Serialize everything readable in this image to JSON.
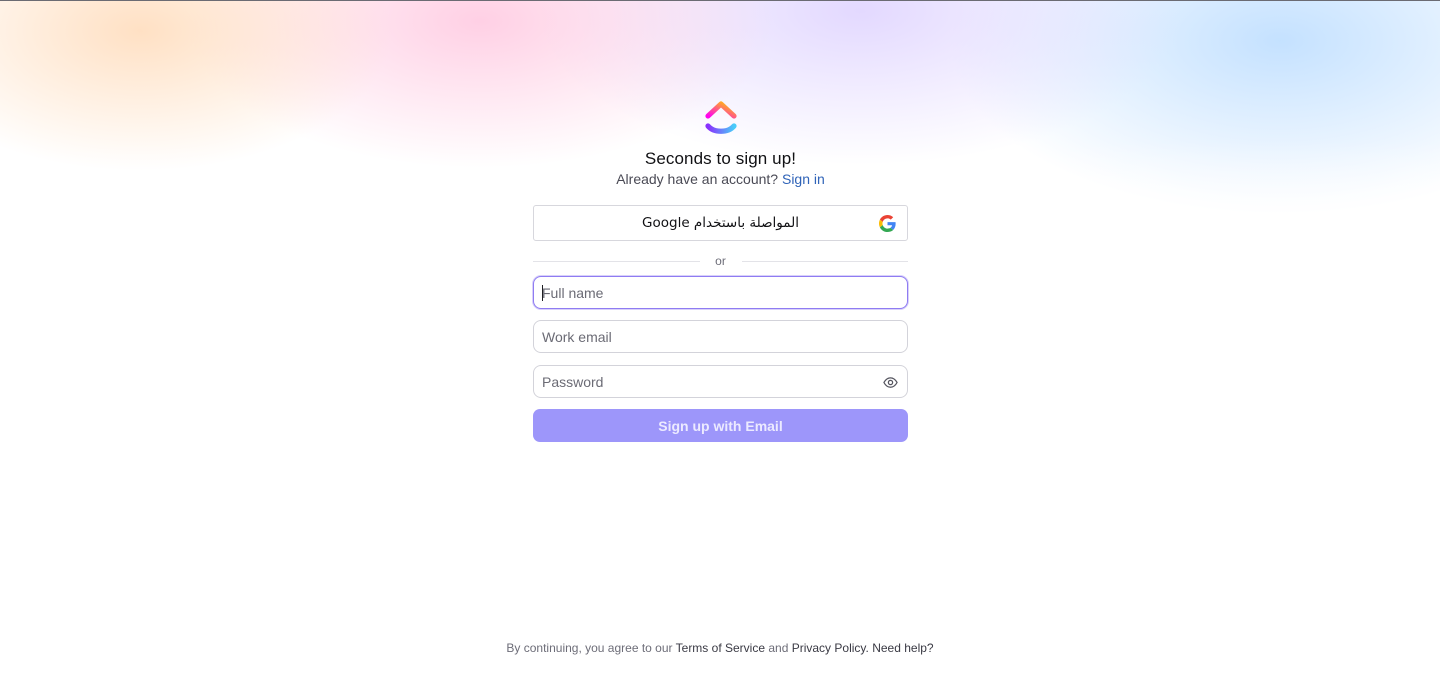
{
  "header": {
    "title": "Seconds to sign up!",
    "subtitle_text": "Already have an account?",
    "signin_link": "Sign in"
  },
  "google": {
    "label": "المواصلة باستخدام Google",
    "icon": "google-icon"
  },
  "divider": {
    "label": "or"
  },
  "form": {
    "full_name": {
      "placeholder": "Full name",
      "value": ""
    },
    "email": {
      "placeholder": "Work email",
      "value": ""
    },
    "password": {
      "placeholder": "Password",
      "value": "",
      "toggle_icon": "eye-icon"
    },
    "submit_label": "Sign up with Email"
  },
  "footer": {
    "prefix": "By continuing, you agree to our",
    "terms": "Terms of Service",
    "and": "and",
    "privacy": "Privacy Policy.",
    "help": "Need help?"
  },
  "colors": {
    "accent": "#9d96fa",
    "link": "#2f63b8",
    "focus_border": "#8f7cf2"
  }
}
